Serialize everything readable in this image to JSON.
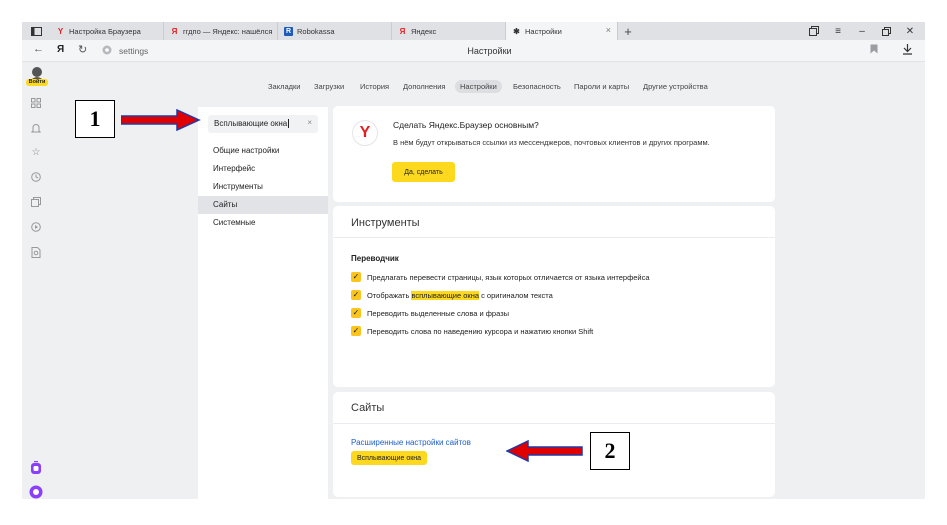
{
  "tabs": [
    {
      "icon": "yandex-y-icon",
      "title": "Настройка Браузера"
    },
    {
      "icon": "yandex-y-icon",
      "title": "ггдпо — Яндекс: нашёлся"
    },
    {
      "icon": "robokassa-icon",
      "title": "Robokassa"
    },
    {
      "icon": "yandex-y-icon",
      "title": "Яндекс"
    },
    {
      "icon": "gear-icon",
      "title": "Настройки",
      "active": true
    }
  ],
  "address": {
    "back": "←",
    "ya": "Я",
    "url": "settings",
    "page_title": "Настройки"
  },
  "account": {
    "label": "Войти"
  },
  "topnav": [
    "Закладки",
    "Загрузки",
    "История",
    "Дополнения",
    "Настройки",
    "Безопасность",
    "Пароли и карты",
    "Другие устройства"
  ],
  "topnav_active": "Настройки",
  "settings_nav": {
    "search_value": "Всплывающие окна",
    "clear": "×",
    "items": [
      "Общие настройки",
      "Интерфейс",
      "Инструменты",
      "Сайты",
      "Системные"
    ],
    "active": "Сайты"
  },
  "promo": {
    "logo": "Y",
    "title": "Сделать Яндекс.Браузер основным?",
    "description": "В нём будут открываться ссылки из мессенджеров, почтовых клиентов и других программ.",
    "button": "Да, сделать"
  },
  "tools": {
    "title": "Инструменты",
    "subtitle": "Переводчик",
    "options": [
      {
        "before": "Предлагать перевести страницы, язык которых отличается от языка интерфейса",
        "highlight": "",
        "after": ""
      },
      {
        "before": "Отображать ",
        "highlight": "всплывающие окна",
        "after": " с оригиналом текста"
      },
      {
        "before": "Переводить выделенные слова и фразы",
        "highlight": "",
        "after": ""
      },
      {
        "before": "Переводить слова по наведению курсора и нажатию кнопки Shift",
        "highlight": "",
        "after": ""
      }
    ]
  },
  "sites": {
    "title": "Сайты",
    "link": "Расширенные настройки сайтов",
    "badge": "Всплывающие окна"
  },
  "annotations": {
    "label1": "1",
    "label2": "2"
  },
  "colors": {
    "accent": "#fcd81f",
    "arrow_red": "#e00000",
    "arrow_blue": "#1e3aa8",
    "link": "#1d5ec9"
  }
}
